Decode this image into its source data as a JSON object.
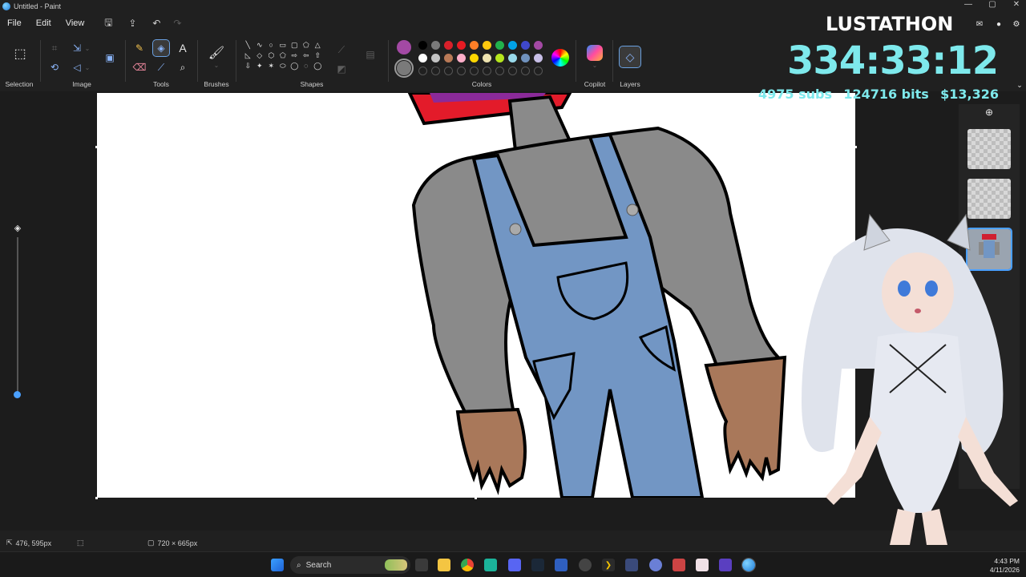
{
  "window": {
    "title": "Untitled - Paint",
    "controls": {
      "minimize": "—",
      "maximize": "▢",
      "close": "✕"
    }
  },
  "menu": {
    "items": [
      "File",
      "Edit",
      "View"
    ]
  },
  "ribbon": {
    "groups": {
      "selection": "Selection",
      "image": "Image",
      "tools": "Tools",
      "brushes": "Brushes",
      "shapes": "Shapes",
      "colors": "Colors",
      "copilot": "Copilot",
      "layers": "Layers"
    },
    "shape_glyphs": [
      "╲",
      "∿",
      "○",
      "▭",
      "▢",
      "⬠",
      "△",
      "◺",
      "◇",
      "⬡",
      "⬠",
      "⇨",
      "⇦",
      "⇧",
      "⇩",
      "✦",
      "✶",
      "⬭",
      "◯",
      "◌",
      "◯"
    ],
    "palette": [
      "#000000",
      "#7a7a7a",
      "#d9202a",
      "#e81b23",
      "#ff7f27",
      "#ffc90e",
      "#22b14c",
      "#00a2e8",
      "#3f48cc",
      "#a349a4",
      "#ffffff",
      "#c3c3c3",
      "#b97a57",
      "#ffaec9",
      "#ffd700",
      "#efe4b0",
      "#b5e61d",
      "#99d9ea",
      "#7092be",
      "#c8bfe7"
    ],
    "primary_color": "#a349a4",
    "secondary_color": "#7a7a7a"
  },
  "overlay": {
    "title": "LUSTATHON",
    "timer": "334:33:12",
    "subs": "4975 subs",
    "bits": "124716 bits",
    "money": "$13,326"
  },
  "statusbar": {
    "cursor_pos": "476, 595px",
    "canvas_size": "720 × 665px"
  },
  "taskbar": {
    "search_placeholder": "Search",
    "time": "4:43 PM",
    "date": "4/11/2026"
  }
}
